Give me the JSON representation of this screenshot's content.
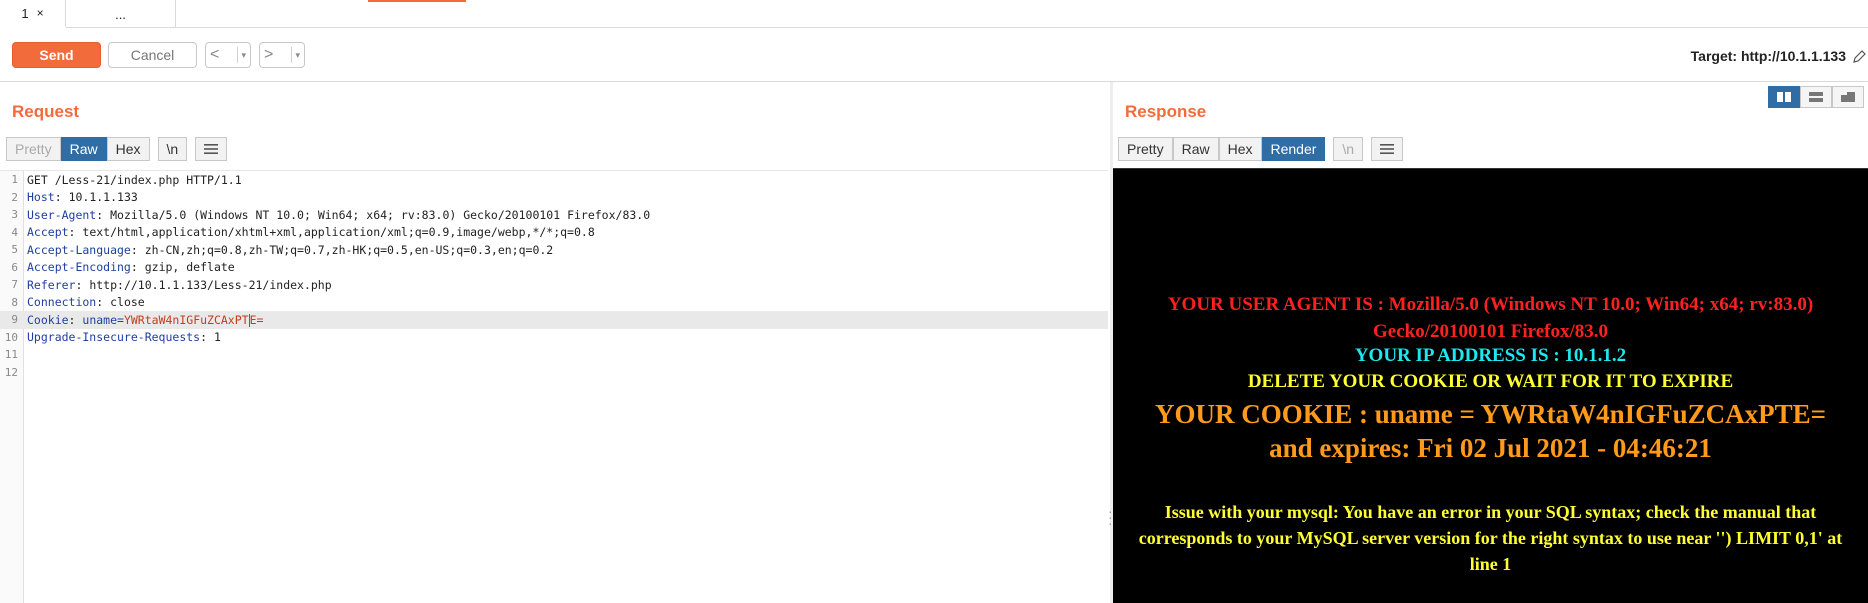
{
  "tabs": [
    {
      "label": "1",
      "close": "×"
    },
    {
      "label": "..."
    }
  ],
  "toolbar": {
    "send_label": "Send",
    "cancel_label": "Cancel",
    "back_label": "<",
    "forward_label": ">",
    "dropdown": "▾",
    "target_label": "Target: http://10.1.1.133"
  },
  "request": {
    "title": "Request",
    "views": [
      "Pretty",
      "Raw",
      "Hex",
      "\\n"
    ],
    "active_view": "Raw",
    "lines": [
      {
        "n": "1",
        "text": "GET /Less-21/index.php HTTP/1.1"
      },
      {
        "n": "2",
        "key": "Host",
        "val": "10.1.1.133"
      },
      {
        "n": "3",
        "key": "User-Agent",
        "val": "Mozilla/5.0 (Windows NT 10.0; Win64; x64; rv:83.0) Gecko/20100101 Firefox/83.0"
      },
      {
        "n": "4",
        "key": "Accept",
        "val": "text/html,application/xhtml+xml,application/xml;q=0.9,image/webp,*/*;q=0.8"
      },
      {
        "n": "5",
        "key": "Accept-Language",
        "val": "zh-CN,zh;q=0.8,zh-TW;q=0.7,zh-HK;q=0.5,en-US;q=0.3,en;q=0.2"
      },
      {
        "n": "6",
        "key": "Accept-Encoding",
        "val": "gzip, deflate"
      },
      {
        "n": "7",
        "key": "Referer",
        "val": "http://10.1.1.133/Less-21/index.php"
      },
      {
        "n": "8",
        "key": "Connection",
        "val": "close"
      },
      {
        "n": "9",
        "key": "Cookie",
        "cookie_name": "uname=",
        "cookie_val_a": "YWRtaW4nIGFuZCAxPT",
        "cookie_val_b": "E="
      },
      {
        "n": "10",
        "key": "Upgrade-Insecure-Requests",
        "val": "1"
      },
      {
        "n": "11",
        "text": ""
      },
      {
        "n": "12",
        "text": ""
      }
    ]
  },
  "response": {
    "title": "Response",
    "views": [
      "Pretty",
      "Raw",
      "Hex",
      "Render",
      "\\n"
    ],
    "active_view": "Render",
    "render": {
      "user_agent": "YOUR USER AGENT IS : Mozilla/5.0 (Windows NT 10.0; Win64; x64; rv:83.0) Gecko/20100101 Firefox/83.0",
      "ip": "YOUR IP ADDRESS IS : 10.1.1.2",
      "delete_notice": "DELETE YOUR COOKIE OR WAIT FOR IT TO EXPIRE",
      "cookie": "YOUR COOKIE : uname = YWRtaW4nIGFuZCAxPTE= and expires: Fri 02 Jul 2021 - 04:46:21",
      "error": "Issue with your mysql: You have an error in your SQL syntax; check the manual that corresponds to your MySQL server version for the right syntax to use near '') LIMIT 0,1' at line 1"
    }
  },
  "colors": {
    "accent": "#f26b3a",
    "active_tab": "#2f6da4",
    "ua_text": "#ff2020",
    "ip_text": "#1ee8ef",
    "notice_text": "#ffff33",
    "cookie_text": "#ff9a1a"
  },
  "icons": {
    "menu": "hamburger-icon",
    "layout": [
      "split-vertical-icon",
      "split-horizontal-icon",
      "tabs-layout-icon"
    ],
    "edit": "pencil-icon"
  }
}
